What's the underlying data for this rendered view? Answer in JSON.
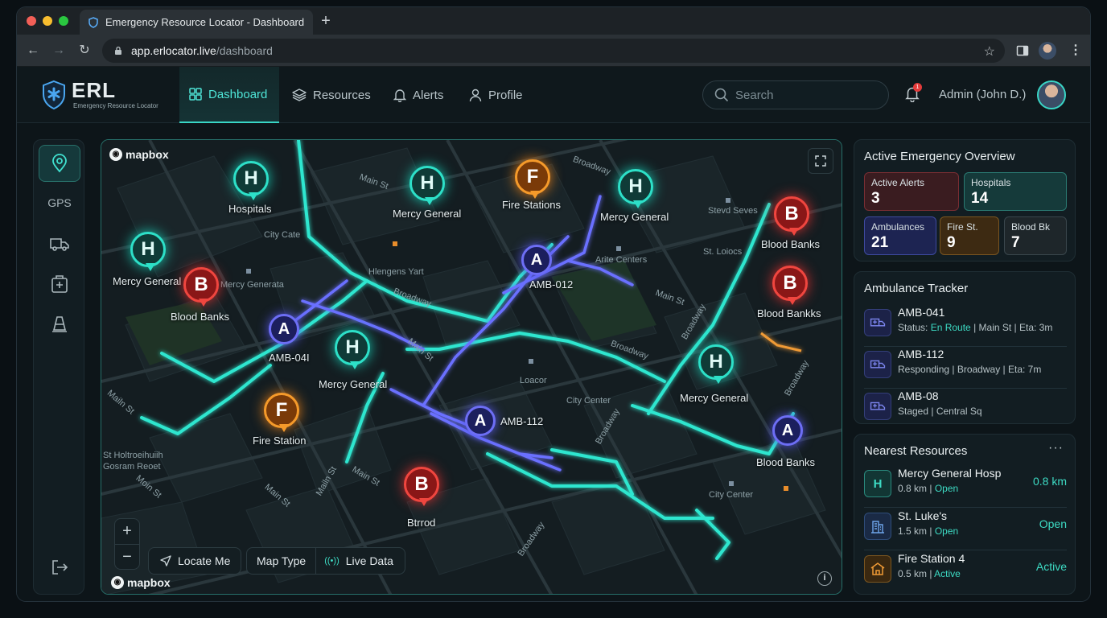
{
  "browser": {
    "tab_title": "Emergency Resource Locator - Dashboard",
    "new_tab": "+",
    "url_host": "app.erlocator.live",
    "url_path": "/dashboard"
  },
  "header": {
    "logo_title": "ERL",
    "logo_subtitle": "Emergency Resource Locator",
    "nav": {
      "dashboard": "Dashboard",
      "resources": "Resources",
      "alerts": "Alerts",
      "profile": "Profile"
    },
    "search_placeholder": "Search",
    "notification_count": "1",
    "user_name": "Admin (John D.)"
  },
  "rail": {
    "gps_label": "GPS"
  },
  "map": {
    "attribution": "mapbox",
    "markers": {
      "hospitals_1": {
        "letter": "H",
        "label": "Hospitals"
      },
      "mercy_1": {
        "letter": "H",
        "label": "Mercy General"
      },
      "fire_1": {
        "letter": "F",
        "label": "Fire Stations"
      },
      "mercy_2": {
        "letter": "H",
        "label": "Mercy General"
      },
      "blood_1": {
        "letter": "B",
        "label": "Blood Banks"
      },
      "mercy_3": {
        "letter": "H",
        "label": "Mercy General"
      },
      "blood_2": {
        "letter": "B",
        "label": "Blood Banks"
      },
      "amb_012": {
        "letter": "A",
        "label": "AMB-012"
      },
      "blood_3": {
        "letter": "B",
        "label": "Blood Bankks"
      },
      "amb_041": {
        "letter": "A",
        "label": "AMB-04I"
      },
      "mercy_4": {
        "letter": "H",
        "label": "Mercy General"
      },
      "mercy_5": {
        "letter": "H",
        "label": "Mercy General"
      },
      "fire_2": {
        "letter": "F",
        "label": "Fire Station"
      },
      "amb_112": {
        "letter": "A",
        "label": "AMB-112"
      },
      "amb_4": {
        "letter": "A",
        "label": "Blood Banks"
      },
      "blood_4": {
        "letter": "B",
        "label": "Btrrod"
      }
    },
    "streets": {
      "s1": "Main St",
      "s2": "Broadway",
      "s3": "City Cate",
      "s4": "Mercy Generata",
      "s5": "Hlengens Yart",
      "s6": "Broadway",
      "s7": "Arite Centers",
      "s8": "Stevd Seves",
      "s9": "St. Loiocs",
      "s10": "Main St",
      "s11": "Broadway",
      "s12": "Loacor",
      "s13": "City Center",
      "s14": "Broadway",
      "s15": "Main St",
      "s16": "St Holtroeihuiih",
      "s17": "Gosram Reoet",
      "s18": "Mailn St",
      "s19": "Moin St",
      "s20": "Main St",
      "s21": "Main St",
      "s22": "Broadway",
      "s23": "City Center",
      "s24": "Broadway",
      "s25": "Broadway",
      "s26": "Mailn St"
    },
    "controls": {
      "zoom_in": "+",
      "zoom_out": "−",
      "locate_me": "Locate Me",
      "map_type": "Map Type",
      "live_data": "Live Data",
      "info": "i"
    }
  },
  "overview": {
    "title": "Active Emergency Overview",
    "stats": {
      "alerts": {
        "label": "Active Alerts",
        "value": "3",
        "color": "#3a1c20"
      },
      "hospitals": {
        "label": "Hospitals",
        "value": "14",
        "color": "#153a3a"
      },
      "ambulances": {
        "label": "Ambulances",
        "value": "21",
        "color": "#1d2452"
      },
      "fire": {
        "label": "Fire St.",
        "value": "9",
        "color": "#3d2a12"
      },
      "blood": {
        "label": "Blood Bk",
        "value": "7",
        "color": "#1e262a"
      }
    }
  },
  "tracker": {
    "title": "Ambulance Tracker",
    "items": [
      {
        "unit": "AMB-041",
        "prefix": "Status: ",
        "status": "En Route",
        "rest": " | Main St | Eta: 3m"
      },
      {
        "unit": "AMB-112",
        "prefix": "",
        "status": "",
        "rest": "Responding | Broadway | Eta: 7m"
      },
      {
        "unit": "AMB-08",
        "prefix": "",
        "status": "",
        "rest": "Staged | Central Sq"
      }
    ]
  },
  "nearest": {
    "title": "Nearest Resources",
    "menu": "···",
    "items": [
      {
        "name": "Mercy General Hosp",
        "distance": "0.8 km",
        "sep": " | ",
        "status": "Open",
        "right": "0.8 km",
        "icon": "H"
      },
      {
        "name": "St. Luke's",
        "distance": "1.5 km",
        "sep": " | ",
        "status": "Open",
        "right": "Open"
      },
      {
        "name": "Fire Station 4",
        "distance": "0.5 km",
        "sep": " | ",
        "status": "Active",
        "right": "Active"
      }
    ]
  }
}
